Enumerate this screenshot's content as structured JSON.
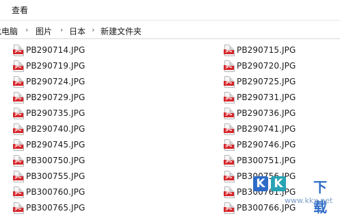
{
  "menu": {
    "view_label": "查看"
  },
  "breadcrumb": {
    "items": [
      "此电脑",
      "图片",
      "日本",
      "新建文件夹"
    ]
  },
  "files": {
    "left": [
      "PB290714.JPG",
      "PB290719.JPG",
      "PB290724.JPG",
      "PB290729.JPG",
      "PB290735.JPG",
      "PB290740.JPG",
      "PB290745.JPG",
      "PB300750.JPG",
      "PB300755.JPG",
      "PB300760.JPG",
      "PB300765.JPG"
    ],
    "right": [
      "PB290715.JPG",
      "PB290720.JPG",
      "PB290725.JPG",
      "PB290731.JPG",
      "PB290736.JPG",
      "PB290741.JPG",
      "PB290746.JPG",
      "PB300751.JPG",
      "PB300756.JPG",
      "PB300761.JPG",
      "PB300766.JPG"
    ],
    "icon": "jpg-file-icon",
    "icon_tag": "JPG"
  },
  "watermark": {
    "letters": [
      "K",
      "K"
    ],
    "text": "下载",
    "url": "www.kkx.net"
  },
  "colors": {
    "jpg_tag": "#d6262b",
    "watermark_blue": "#2d6bc7",
    "watermark_teal": "#27a3b4"
  }
}
